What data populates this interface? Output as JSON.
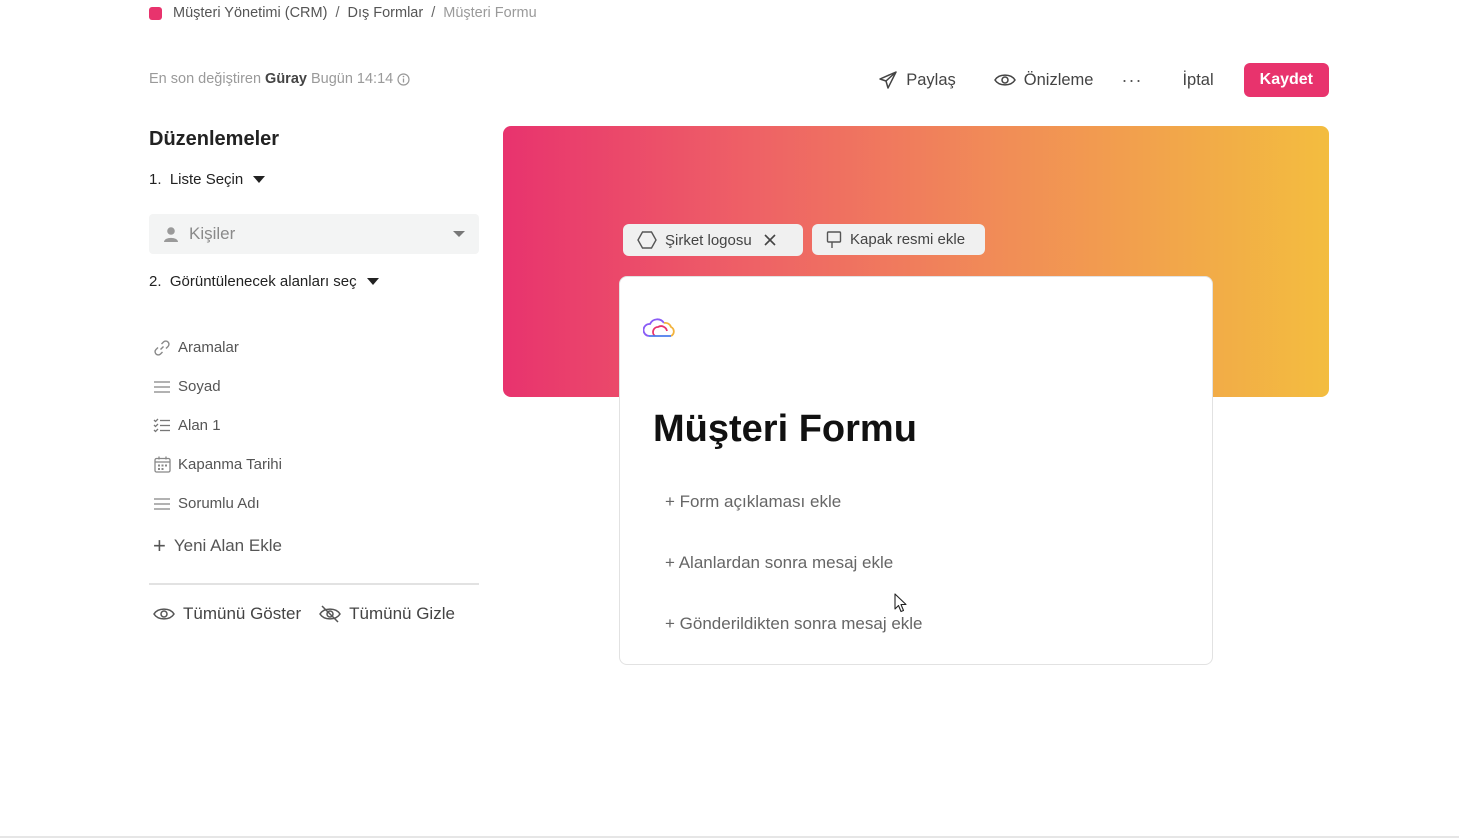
{
  "breadcrumb": {
    "items": [
      "Müşteri Yönetimi (CRM)",
      "Dış Formlar"
    ],
    "current": "Müşteri Formu",
    "separator": "/",
    "dot_color": "#e8336d"
  },
  "meta": {
    "prefix": "En son değiştiren",
    "user": "Güray",
    "time": "Bugün 14:14"
  },
  "toolbar": {
    "share": "Paylaş",
    "preview": "Önizleme",
    "more": "···",
    "cancel": "İptal",
    "save": "Kaydet",
    "accent": "#e8336d"
  },
  "panel": {
    "title": "Düzenlemeler",
    "step1": "1.  Liste Seçin",
    "list_value": "Kişiler",
    "step2": "2.  Görüntülenecek alanları seç",
    "fields": [
      {
        "label": "Aramalar",
        "icon": "link-icon"
      },
      {
        "label": "Soyad",
        "icon": "text-lines-icon"
      },
      {
        "label": "Alan 1",
        "icon": "checklist-icon"
      },
      {
        "label": "Kapanma Tarihi",
        "icon": "calendar-icon"
      },
      {
        "label": "Sorumlu Adı",
        "icon": "text-lines-icon"
      }
    ],
    "add_field": "Yeni Alan Ekle",
    "show_all": "Tümünü Göster",
    "hide_all": "Tümünü Gizle"
  },
  "cover": {
    "logo_chip": "Şirket logosu",
    "cover_chip": "Kapak resmi ekle"
  },
  "form": {
    "title": "Müşteri Formu",
    "add_description": "+ Form açıklaması ekle",
    "add_after_fields": "+ Alanlardan sonra mesaj ekle",
    "add_after_submit": "+ Gönderildikten sonra mesaj ekle"
  }
}
